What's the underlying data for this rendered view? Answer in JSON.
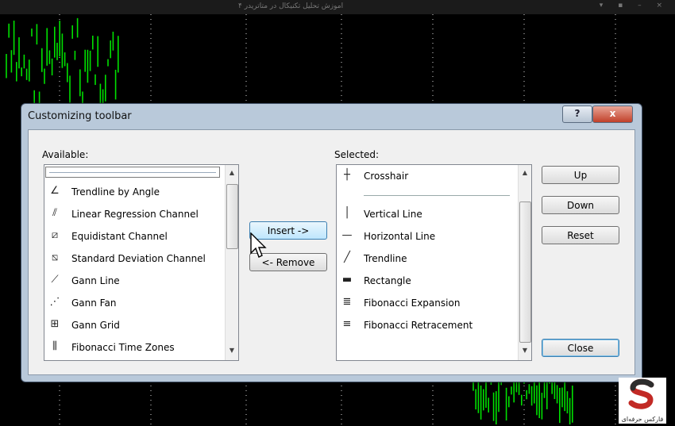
{
  "window": {
    "title": "اموزش تحلیل تکنیکال در متاتریدر ۴"
  },
  "dialog": {
    "title": "Customizing toolbar",
    "help_label": "?",
    "close_label": "x",
    "available_label": "Available:",
    "selected_label": "Selected:"
  },
  "available": {
    "items": [
      {
        "label": "Trendline by Angle",
        "icon": "trendline-angle-icon"
      },
      {
        "label": "Linear Regression Channel",
        "icon": "regression-channel-icon"
      },
      {
        "label": "Equidistant Channel",
        "icon": "equidistant-channel-icon"
      },
      {
        "label": "Standard Deviation Channel",
        "icon": "stddev-channel-icon"
      },
      {
        "label": "Gann Line",
        "icon": "gann-line-icon"
      },
      {
        "label": "Gann Fan",
        "icon": "gann-fan-icon"
      },
      {
        "label": "Gann Grid",
        "icon": "gann-grid-icon"
      },
      {
        "label": "Fibonacci Time Zones",
        "icon": "fibo-time-zones-icon"
      }
    ]
  },
  "selected": {
    "items": [
      {
        "label": "Crosshair",
        "icon": "crosshair-icon"
      },
      {
        "label": "Vertical Line",
        "icon": "vertical-line-icon"
      },
      {
        "label": "Horizontal Line",
        "icon": "horizontal-line-icon"
      },
      {
        "label": "Trendline",
        "icon": "trendline-icon"
      },
      {
        "label": "Rectangle",
        "icon": "rectangle-icon"
      },
      {
        "label": "Fibonacci Expansion",
        "icon": "fibo-expansion-icon"
      },
      {
        "label": "Fibonacci Retracement",
        "icon": "fibo-retracement-icon"
      }
    ],
    "highlighted": "Fibonacci Retracement"
  },
  "buttons": {
    "insert": "Insert ->",
    "remove": "<- Remove",
    "up": "Up",
    "down": "Down",
    "reset": "Reset",
    "close": "Close"
  },
  "watermark": {
    "text": "فارکس حرفه‌ای",
    "icon": "brand-logo-icon"
  },
  "colors": {
    "candles": "#00e000",
    "dialog_frame": "#b9c9da",
    "selection": "#dbe8f7",
    "close_button": "#c1402a"
  }
}
